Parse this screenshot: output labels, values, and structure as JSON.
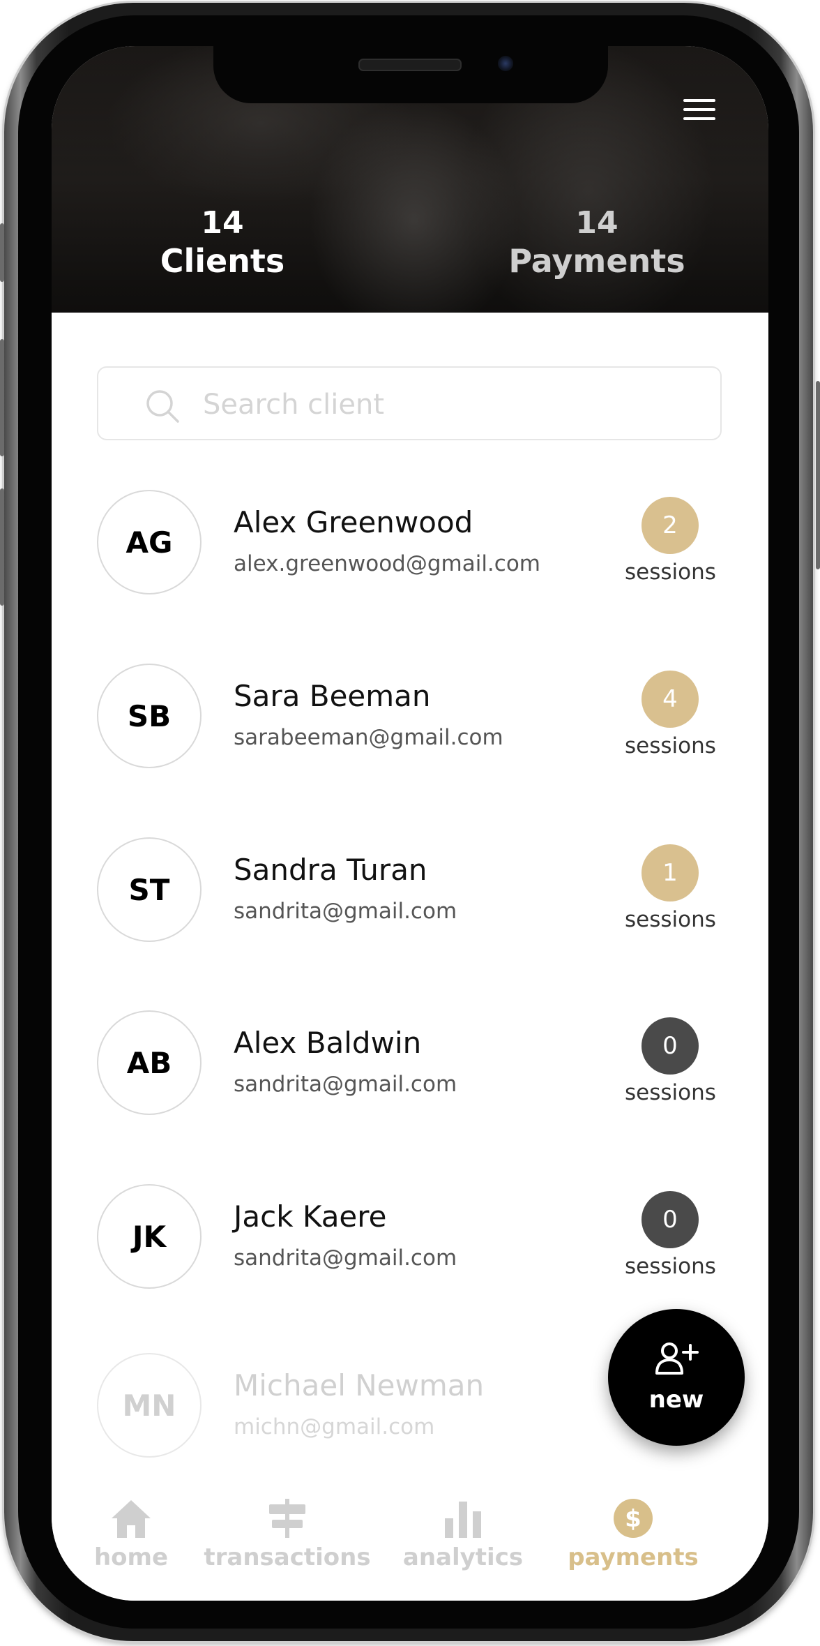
{
  "header": {
    "stats": [
      {
        "value": "14",
        "label": "Clients"
      },
      {
        "value": "14",
        "label": "Payments"
      }
    ]
  },
  "search": {
    "placeholder": "Search client"
  },
  "clients": [
    {
      "initials": "AG",
      "name": "Alex Greenwood",
      "email": "alex.greenwood@gmail.com",
      "sessions": "2",
      "sessions_label": "sessions",
      "badge_color": "#d9c08f"
    },
    {
      "initials": "SB",
      "name": "Sara Beeman",
      "email": "sarabeeman@gmail.com",
      "sessions": "4",
      "sessions_label": "sessions",
      "badge_color": "#d9c08f"
    },
    {
      "initials": "ST",
      "name": "Sandra Turan",
      "email": "sandrita@gmail.com",
      "sessions": "1",
      "sessions_label": "sessions",
      "badge_color": "#d9c08f"
    },
    {
      "initials": "AB",
      "name": "Alex Baldwin",
      "email": "sandrita@gmail.com",
      "sessions": "0",
      "sessions_label": "sessions",
      "badge_color": "#4a4a4a"
    },
    {
      "initials": "JK",
      "name": "Jack Kaere",
      "email": "sandrita@gmail.com",
      "sessions": "0",
      "sessions_label": "sessions",
      "badge_color": "#4a4a4a"
    },
    {
      "initials": "MN",
      "name": "Michael Newman",
      "email": "michn@gmail.com"
    }
  ],
  "fab": {
    "label": "new",
    "icon": "add-user-icon"
  },
  "nav": [
    {
      "label": "home",
      "icon": "home-icon"
    },
    {
      "label": "transactions",
      "icon": "transactions-icon"
    },
    {
      "label": "analytics",
      "icon": "analytics-icon"
    },
    {
      "label": "payments",
      "icon": "dollar-icon",
      "active": true
    }
  ],
  "colors": {
    "accent": "#d8bf8a",
    "inactive": "#cfcfcf",
    "badge_dark": "#4a4a4a"
  }
}
